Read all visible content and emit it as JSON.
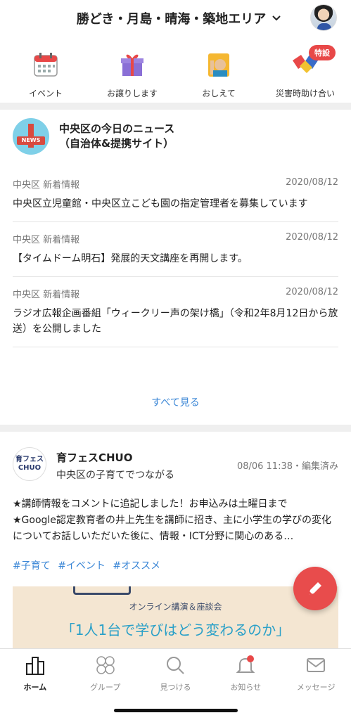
{
  "header": {
    "area_title": "勝どき・月島・晴海・築地エリア"
  },
  "quick_menu": [
    {
      "label": "イベント",
      "icon": "calendar-icon"
    },
    {
      "label": "お譲りします",
      "icon": "gift-icon"
    },
    {
      "label": "おしえて",
      "icon": "raise-hand-icon"
    },
    {
      "label": "災害時助け合い",
      "icon": "handshake-icon",
      "badge": "特設"
    }
  ],
  "news": {
    "title_line1": "中央区の今日のニュース",
    "title_line2": "（自治体&提携サイト）",
    "logo_text": "NEWS",
    "items": [
      {
        "source": "中央区 新着情報",
        "date": "2020/08/12",
        "text": "中央区立児童館・中央区立こども園の指定管理者を募集しています"
      },
      {
        "source": "中央区 新着情報",
        "date": "2020/08/12",
        "text": "【タイムドーム明石】発展的天文講座を再開します。"
      },
      {
        "source": "中央区 新着情報",
        "date": "2020/08/12",
        "text": "ラジオ広報企画番組「ウィークリー声の架け橋」（令和2年8月12日から放送）を公開しました"
      }
    ],
    "see_all": "すべて見る"
  },
  "post": {
    "logo_line1": "育フェス",
    "logo_line2": "CHUO",
    "name": "育フェスCHUO",
    "subtitle": "中央区の子育てでつながる",
    "time": "08/06 11:38・編集済み",
    "text_line1": "★講師情報をコメントに追記しました！お申込みは土曜日まで",
    "text_line2": "★Google認定教育者の井上先生を講師に招き、主に小学生の学びの変化についてお話しいただいた後に、情報・ICT分野に関心のある…",
    "tags": [
      "#子育て",
      "#イベント",
      "#オススメ"
    ],
    "banner_sub": "オンライン講演＆座談会",
    "banner_main": "「1人1台で学びはどう変わるのか」"
  },
  "bottom_nav": [
    {
      "label": "ホーム",
      "icon": "home-buildings-icon"
    },
    {
      "label": "グループ",
      "icon": "group-icon"
    },
    {
      "label": "見つける",
      "icon": "search-icon"
    },
    {
      "label": "お知らせ",
      "icon": "bell-icon"
    },
    {
      "label": "メッセージ",
      "icon": "mail-icon"
    }
  ],
  "colors": {
    "accent": "#e84848",
    "link": "#3a86d6"
  }
}
